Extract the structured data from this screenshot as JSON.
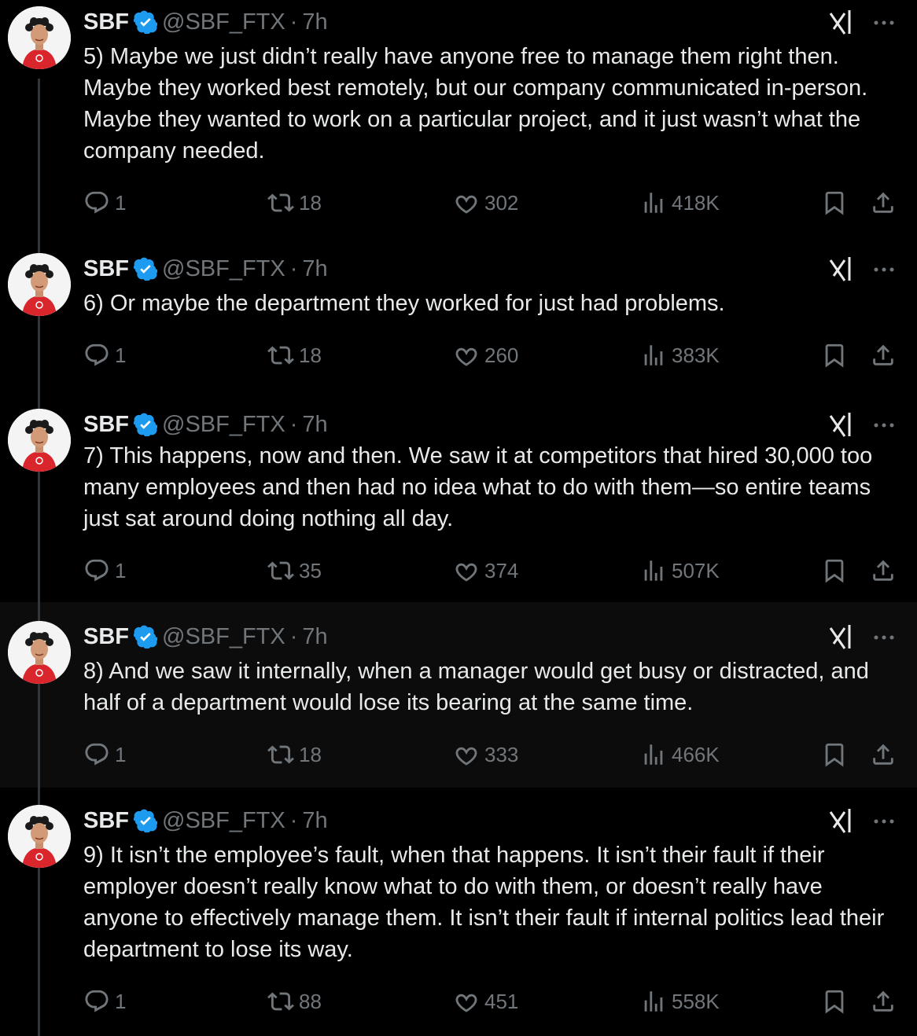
{
  "author": {
    "name": "SBF",
    "handle": "@SBF_FTX",
    "separator": "·",
    "time": "7h"
  },
  "colors": {
    "background": "#000000",
    "highlight": "#0c0c0c",
    "text": "#e7e9ea",
    "muted": "#71767b",
    "verified": "#1d9bf0",
    "thread_line": "#333639"
  },
  "icons": [
    "verified-badge-icon",
    "grok-icon",
    "more-icon",
    "reply-icon",
    "retweet-icon",
    "like-icon",
    "views-icon",
    "bookmark-icon",
    "share-icon"
  ],
  "tweets": [
    {
      "text": "5) Maybe we just didn’t really have anyone free to manage them right then. Maybe they worked best remotely, but our company communicated in-person. Maybe they wanted to work on a particular project, and it just wasn’t what the company needed.",
      "replies": "1",
      "retweets": "18",
      "likes": "302",
      "views": "418K"
    },
    {
      "text": "6) Or maybe the department they worked for just had problems.",
      "replies": "1",
      "retweets": "18",
      "likes": "260",
      "views": "383K"
    },
    {
      "text": "7) This happens, now and then. We saw it at competitors that hired 30,000 too many employees and then had no idea what to do with them—so entire teams just sat around doing nothing all day.",
      "replies": "1",
      "retweets": "35",
      "likes": "374",
      "views": "507K"
    },
    {
      "text": "8) And we saw it internally, when a manager would get busy or distracted, and half of a department would lose its bearing at the same time.",
      "replies": "1",
      "retweets": "18",
      "likes": "333",
      "views": "466K"
    },
    {
      "text": "9) It isn’t the employee’s fault, when that happens. It isn’t their fault if their employer doesn’t really know what to do with them, or doesn’t really have anyone to effectively manage them. It isn’t their fault if internal politics lead their department to lose its way.",
      "replies": "1",
      "retweets": "88",
      "likes": "451",
      "views": "558K"
    }
  ]
}
